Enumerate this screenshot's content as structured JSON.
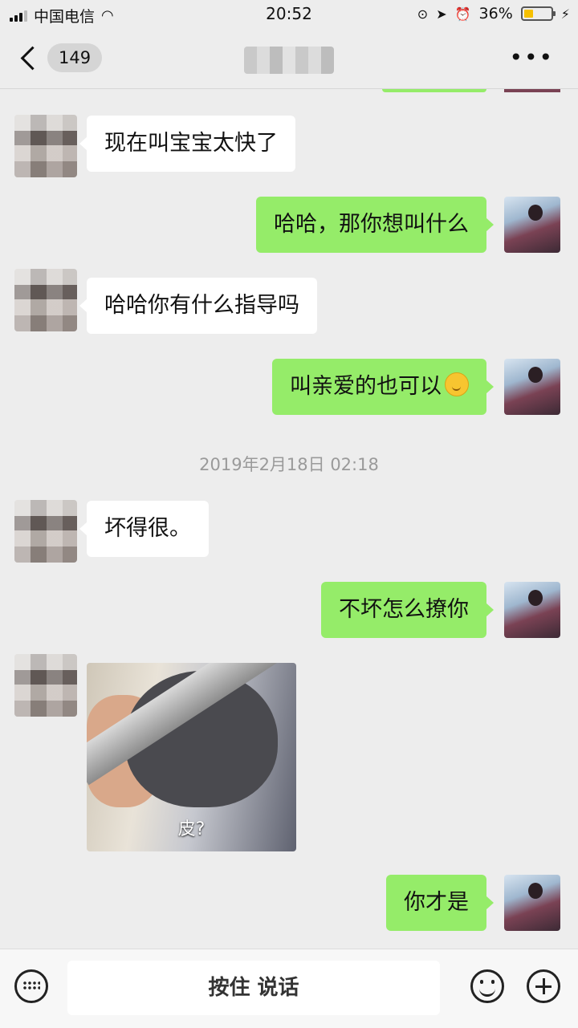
{
  "status_bar": {
    "carrier": "中国电信",
    "time": "20:52",
    "battery_percent": "36%",
    "battery_level": 0.36
  },
  "nav": {
    "unread_count": "149",
    "more_icon": "ellipsis-icon"
  },
  "messages": [
    {
      "from": "other",
      "text": "现在叫宝宝太快了"
    },
    {
      "from": "self",
      "text": "哈哈，那你想叫什么"
    },
    {
      "from": "other",
      "text": "哈哈你有什么指导吗"
    },
    {
      "from": "self",
      "text": "叫亲爱的也可以",
      "emoji": "thinking-face-icon"
    },
    {
      "type": "timestamp",
      "text": "2019年2月18日 02:18"
    },
    {
      "from": "other",
      "text": "坏得很。"
    },
    {
      "from": "self",
      "text": "不坏怎么撩你"
    },
    {
      "from": "other",
      "type": "sticker",
      "caption": "皮?"
    },
    {
      "from": "self",
      "text": "你才是"
    }
  ],
  "input_bar": {
    "hold_to_talk": "按住 说话",
    "keyboard_icon": "keyboard-icon",
    "emoji_icon": "smiley-icon",
    "plus_icon": "plus-icon"
  },
  "colors": {
    "outgoing_bubble": "#95ec69",
    "incoming_bubble": "#ffffff",
    "background": "#ededed"
  }
}
